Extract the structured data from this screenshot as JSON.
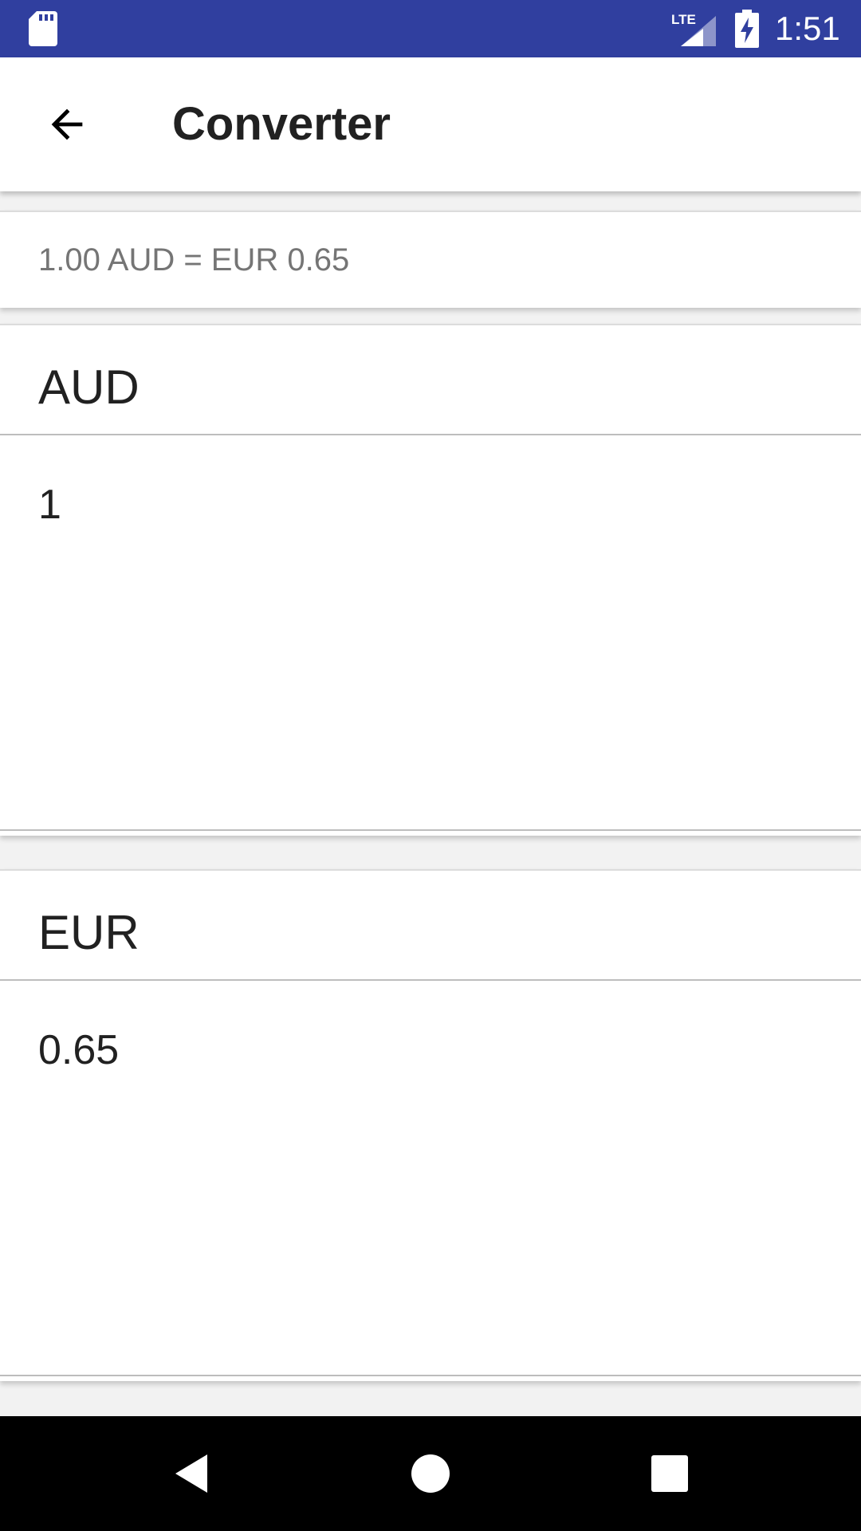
{
  "status_bar": {
    "time": "1:51",
    "network_label": "LTE",
    "icons": [
      "sd-card-icon",
      "lte-signal-icon",
      "battery-charging-icon"
    ],
    "background_color": "#303f9f"
  },
  "app_bar": {
    "title": "Converter",
    "back_icon": "arrow-back-icon"
  },
  "rate": {
    "text": "1.00 AUD = EUR 0.65"
  },
  "from_currency": {
    "code": "AUD",
    "amount": "1"
  },
  "to_currency": {
    "code": "EUR",
    "amount": "0.65"
  },
  "nav_bar": {
    "icons": [
      "nav-back-icon",
      "nav-home-icon",
      "nav-recents-icon"
    ]
  }
}
